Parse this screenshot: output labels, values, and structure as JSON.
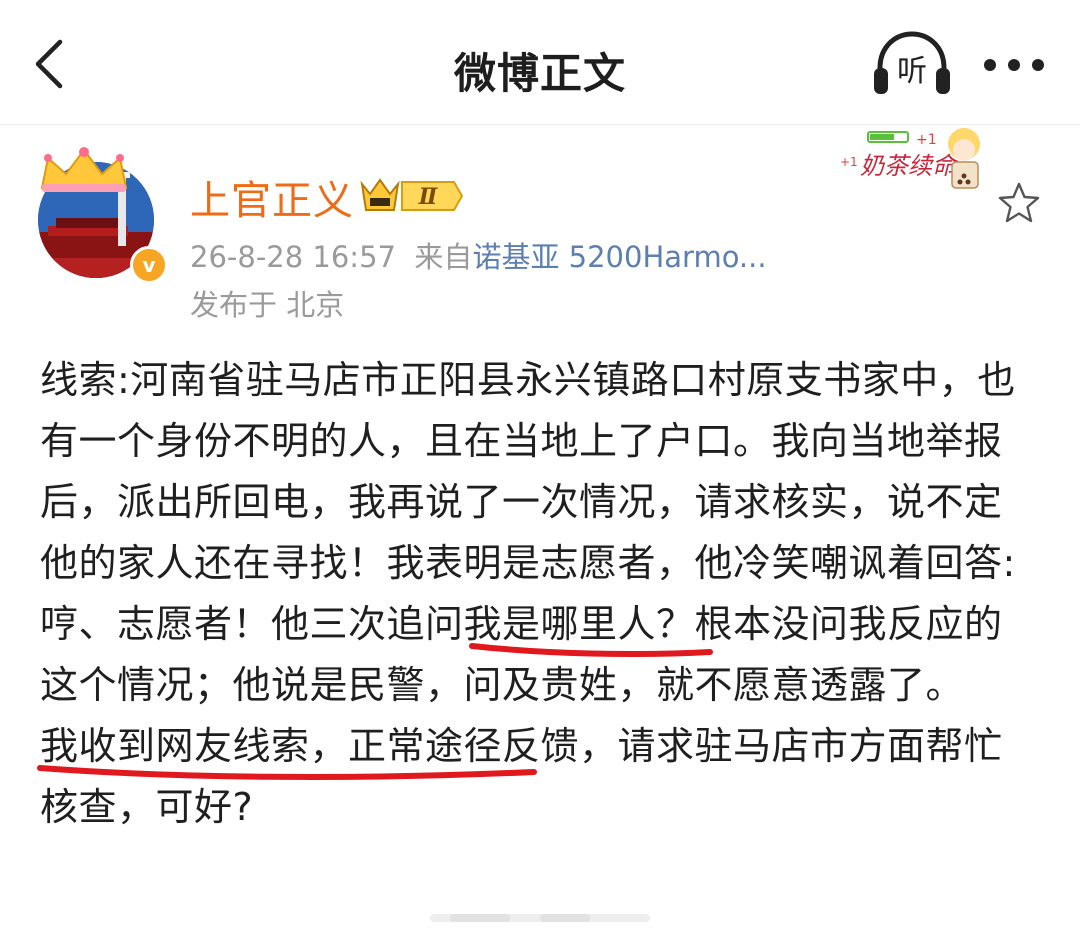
{
  "header": {
    "title": "微博正文",
    "listen_label": "听",
    "icons": {
      "back": "chevron-left-icon",
      "listen": "headphones-icon",
      "more": "more-dots-icon"
    }
  },
  "author": {
    "name": "上官正义",
    "vip_level": "Ⅱ",
    "verified_mark": "v",
    "timestamp": "26-8-28 16:57",
    "source_prefix": "来自",
    "source_device": "诺基亚 5200Harmo...",
    "location": "发布于 北京",
    "colors": {
      "name": "#f06b16",
      "badge": "#f6a623",
      "source_link": "#5b7fb0"
    }
  },
  "sticker": {
    "text": "奶茶续命",
    "plus_label": "+1"
  },
  "post": {
    "paragraph_1_intro": "线索:河南省驻马店市正阳县永兴镇路口村原支书家中，也有一个身份不明的人，且在当地上了户口。我向当地举报后，派出所回电，我再说了一次情况，请求核实，说不定他的家人还在寻找！我表明是志愿者，他冷笑嘲讽着回答:",
    "highlight_1": "哼、志愿者！",
    "paragraph_1_middle": "他三次追问我是哪里人？根本没问我反应的这个情况；他说是民警，",
    "highlight_2": "问及贵姓，就不愿意透露了",
    "paragraph_1_end": "。",
    "paragraph_2": "我收到网友线索，正常途径反馈，请求驻马店市方面帮忙核查，可好?",
    "underline_color": "#e0191f"
  }
}
